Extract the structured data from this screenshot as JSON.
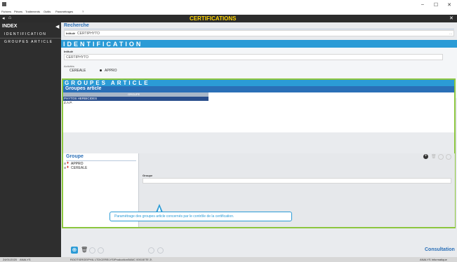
{
  "menu": {
    "items": [
      "Fichiers",
      "Pièces",
      "Traitements",
      "Outils",
      "Paramétrages",
      "?"
    ]
  },
  "window_controls": {
    "minimize": "–",
    "maximize": "☐",
    "close": "✕"
  },
  "header": {
    "title": "CERTIFICATIONS",
    "close": "✕"
  },
  "sidebar": {
    "title": "INDEX",
    "items": [
      {
        "label": "IDENTIFICATION"
      },
      {
        "label": "GROUPES ARTICLE"
      }
    ]
  },
  "recherche": {
    "title": "Recherche",
    "label": "Intitulé",
    "value": "CERTIPHYTO",
    "more": "..."
  },
  "identification": {
    "title": "IDENTIFICATION",
    "intitule_label": "Intitulé",
    "intitule_value": "CERTIPHYTO",
    "activites_label": "Activités",
    "options": [
      "CEREALE",
      "APPRO"
    ],
    "selected": "APPRO"
  },
  "groupes_article": {
    "section_title": "GROUPES ARTICLE",
    "subtitle": "Groupes article",
    "column_header": "GROUPE",
    "rows": [
      "PHYTOS HERBICIDES",
      "Z.A.P."
    ],
    "selected_row": "PHYTOS HERBICIDES"
  },
  "groupe": {
    "title": "Groupe",
    "tree": [
      "APPRO",
      "CEREALE"
    ],
    "field_label": "Groupe",
    "field_value": ""
  },
  "tooltip": {
    "text": "Paramétrage des groupes article concernés par le contrôle de la certification."
  },
  "footer": {
    "mode": "Consultation"
  },
  "status": {
    "date": "24/01/2020",
    "user": "ANALYS",
    "path": "ROOT\\SRGE\\PHIL LTD\\CERELYS\\Production\\MAIC 0001\\ETE 2\\",
    "company": "ANALYS Informatique"
  },
  "colors": {
    "accent": "#2b9bd6",
    "highlight_border": "#8cc63f",
    "header_bg": "#2c2c2c",
    "title_color": "#ffd400",
    "sidebar_bg": "#2e2e2e"
  }
}
